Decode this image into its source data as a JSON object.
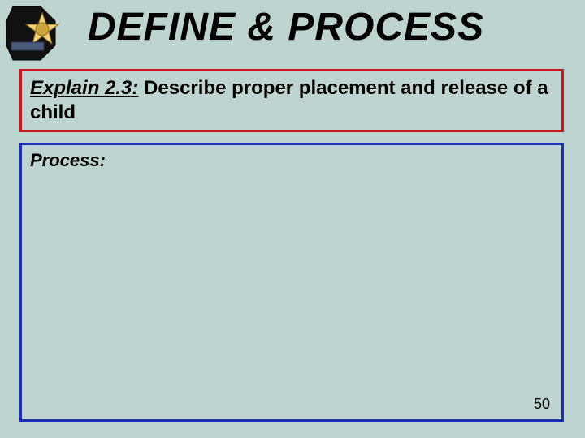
{
  "slide": {
    "title": "DEFINE & PROCESS",
    "page_number": "50"
  },
  "explain": {
    "label": "Explain 2.3:",
    "body": " Describe proper placement and release of a child"
  },
  "process": {
    "label": "Process:"
  },
  "logo": {
    "name": "constable-badge-logo"
  }
}
